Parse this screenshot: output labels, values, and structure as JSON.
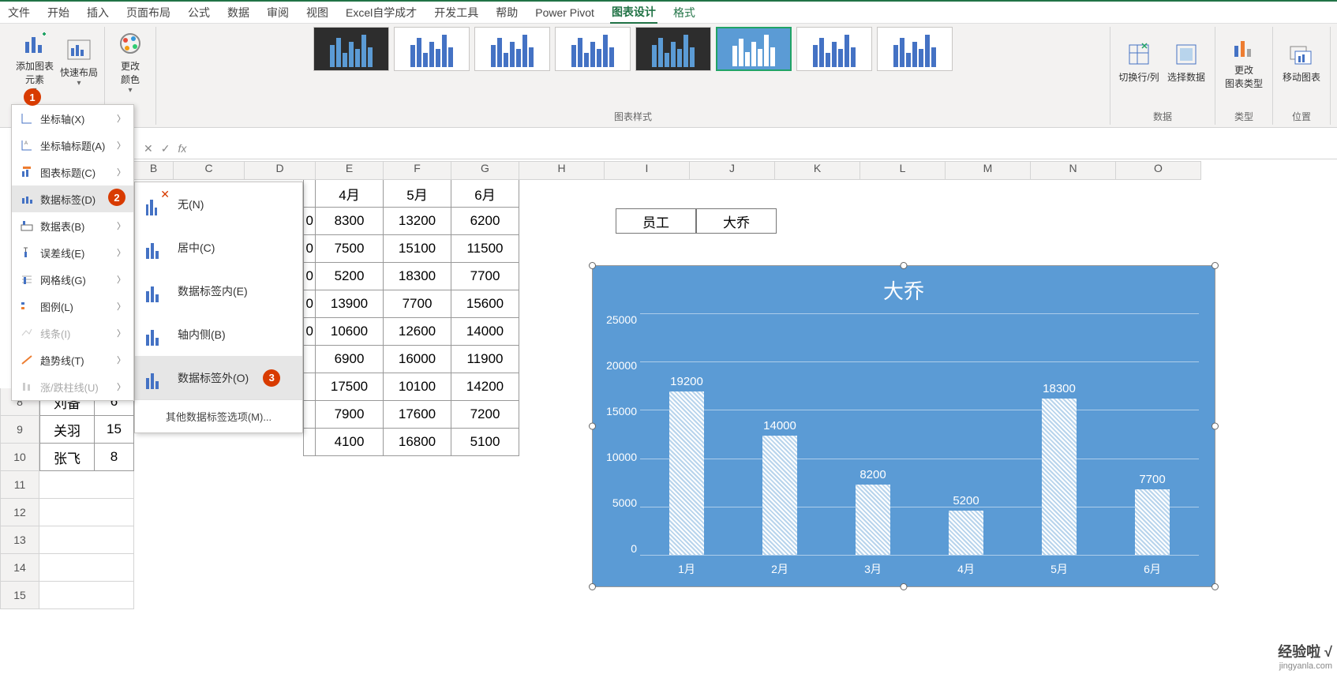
{
  "menubar": {
    "tabs": [
      "文件",
      "开始",
      "插入",
      "页面布局",
      "公式",
      "数据",
      "审阅",
      "视图",
      "Excel自学成才",
      "开发工具",
      "帮助",
      "Power Pivot",
      "图表设计",
      "格式"
    ],
    "active": "图表设计"
  },
  "ribbon": {
    "add_element": "添加图表\n元素",
    "quick_layout": "快速布局",
    "change_colors": "更改\n颜色",
    "switch_rowcol": "切换行/列",
    "select_data": "选择数据",
    "change_type": "更改\n图表类型",
    "move_chart": "移动图表",
    "group_styles": "图表样式",
    "group_data": "数据",
    "group_type": "类型",
    "group_location": "位置"
  },
  "dropdown1": {
    "items": [
      {
        "label": "坐标轴(X)",
        "icon": "axis-icon"
      },
      {
        "label": "坐标轴标题(A)",
        "icon": "axis-title-icon"
      },
      {
        "label": "图表标题(C)",
        "icon": "chart-title-icon"
      },
      {
        "label": "数据标签(D)",
        "icon": "data-label-icon",
        "highlight": true
      },
      {
        "label": "数据表(B)",
        "icon": "data-table-icon"
      },
      {
        "label": "误差线(E)",
        "icon": "error-bars-icon"
      },
      {
        "label": "网格线(G)",
        "icon": "gridlines-icon"
      },
      {
        "label": "图例(L)",
        "icon": "legend-icon"
      },
      {
        "label": "线条(I)",
        "icon": "lines-icon",
        "disabled": true
      },
      {
        "label": "趋势线(T)",
        "icon": "trendline-icon"
      },
      {
        "label": "涨/跌柱线(U)",
        "icon": "updown-bars-icon",
        "disabled": true
      }
    ]
  },
  "dropdown2": {
    "items": [
      {
        "label": "无(N)",
        "icon": "none-icon"
      },
      {
        "label": "居中(C)",
        "icon": "center-icon"
      },
      {
        "label": "数据标签内(E)",
        "icon": "inside-end-icon"
      },
      {
        "label": "轴内侧(B)",
        "icon": "inside-base-icon"
      },
      {
        "label": "数据标签外(O)",
        "icon": "outside-end-icon",
        "highlight": true
      }
    ],
    "footer": "其他数据标签选项(M)..."
  },
  "badges": {
    "b1": "1",
    "b2": "2",
    "b3": "3"
  },
  "columns": [
    "B",
    "C",
    "D",
    "E",
    "F",
    "G",
    "H",
    "I",
    "J",
    "K",
    "L",
    "M",
    "N",
    "O"
  ],
  "rows_visible": [
    "8",
    "9",
    "10",
    "11",
    "12",
    "13",
    "14",
    "15"
  ],
  "table": {
    "header": {
      "e": "4月",
      "f": "5月",
      "g": "6月"
    },
    "rows": [
      {
        "e": "8300",
        "f": "13200",
        "g": "6200"
      },
      {
        "e": "7500",
        "f": "15100",
        "g": "11500"
      },
      {
        "e": "5200",
        "f": "18300",
        "g": "7700"
      },
      {
        "e": "13900",
        "f": "7700",
        "g": "15600"
      },
      {
        "e": "10600",
        "f": "12600",
        "g": "14000"
      },
      {
        "e": "6900",
        "f": "16000",
        "g": "11900"
      },
      {
        "e": "17500",
        "f": "10100",
        "g": "14200"
      },
      {
        "e": "7900",
        "f": "17600",
        "g": "7200"
      },
      {
        "e": "4100",
        "f": "16800",
        "g": "5100"
      }
    ],
    "partial_left": [
      {
        "r": "8",
        "b": "刘备",
        "c": "6"
      },
      {
        "r": "9",
        "b": "关羽",
        "c": "15"
      },
      {
        "r": "10",
        "b": "张飞",
        "c": "8"
      }
    ],
    "partial_d": [
      "0",
      "0",
      "0",
      "0",
      "0"
    ]
  },
  "mini_table": {
    "h1": "员工",
    "h2": "大乔"
  },
  "chart_data": {
    "type": "bar",
    "title": "大乔",
    "categories": [
      "1月",
      "2月",
      "3月",
      "4月",
      "5月",
      "6月"
    ],
    "values": [
      19200,
      14000,
      8200,
      5200,
      18300,
      7700
    ],
    "ylabel": "",
    "yticks": [
      0,
      5000,
      10000,
      15000,
      20000,
      25000
    ],
    "ylim": [
      0,
      25000
    ]
  },
  "watermark": {
    "line1": "经验啦 √",
    "line2": "jingyanla.com"
  }
}
